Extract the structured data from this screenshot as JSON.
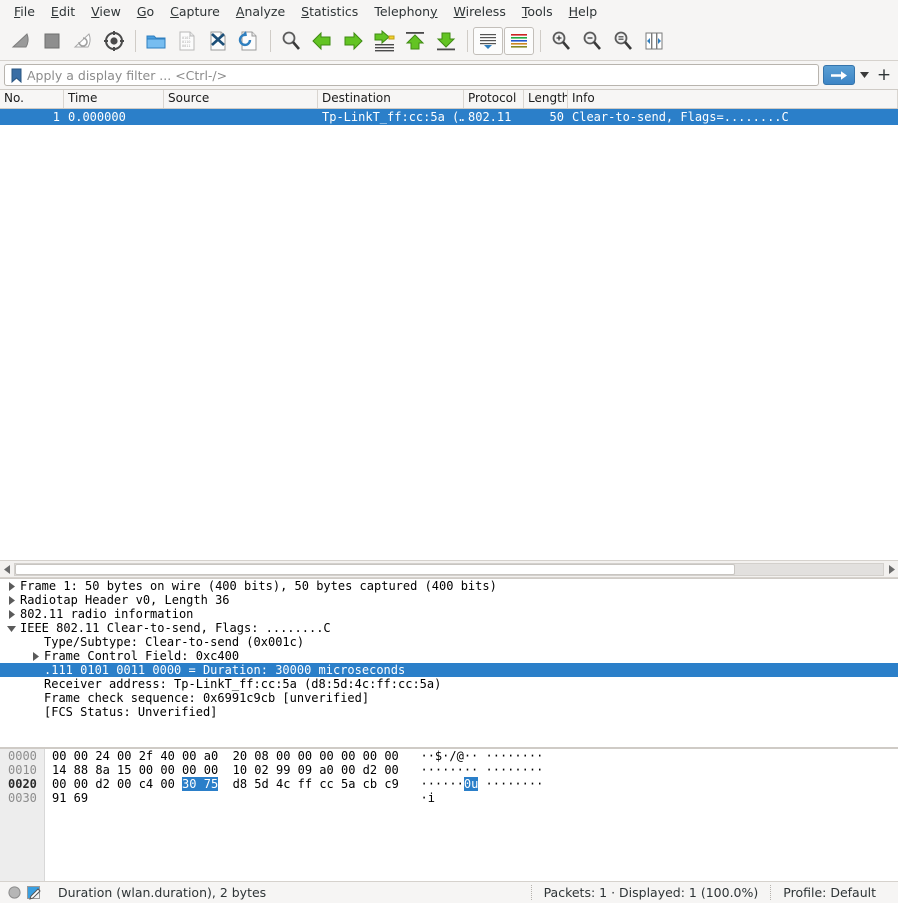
{
  "menu": {
    "items": [
      {
        "label": "File",
        "mnemonic": "F"
      },
      {
        "label": "Edit",
        "mnemonic": "E"
      },
      {
        "label": "View",
        "mnemonic": "V"
      },
      {
        "label": "Go",
        "mnemonic": "G"
      },
      {
        "label": "Capture",
        "mnemonic": "C"
      },
      {
        "label": "Analyze",
        "mnemonic": "A"
      },
      {
        "label": "Statistics",
        "mnemonic": "S"
      },
      {
        "label": "Telephony",
        "mnemonic": "T"
      },
      {
        "label": "Wireless",
        "mnemonic": "W"
      },
      {
        "label": "Tools",
        "mnemonic": "T"
      },
      {
        "label": "Help",
        "mnemonic": "H"
      }
    ]
  },
  "toolbar": {
    "buttons": [
      {
        "name": "start-capture-icon",
        "title": "Start capturing packets"
      },
      {
        "name": "stop-capture-icon",
        "title": "Stop capturing packets"
      },
      {
        "name": "restart-capture-icon",
        "title": "Restart current capture"
      },
      {
        "name": "capture-options-icon",
        "title": "Capture options"
      },
      {
        "name": "open-file-icon",
        "title": "Open a capture file"
      },
      {
        "name": "save-file-icon",
        "title": "Save this capture file"
      },
      {
        "name": "close-file-icon",
        "title": "Close this capture file"
      },
      {
        "name": "reload-file-icon",
        "title": "Reload this file"
      },
      {
        "name": "find-packet-icon",
        "title": "Find a packet"
      },
      {
        "name": "go-back-icon",
        "title": "Go back in packet history"
      },
      {
        "name": "go-forward-icon",
        "title": "Go forward in packet history"
      },
      {
        "name": "go-to-packet-icon",
        "title": "Go to the packet with number"
      },
      {
        "name": "go-to-first-icon",
        "title": "Go to the first packet"
      },
      {
        "name": "go-to-last-icon",
        "title": "Go to the last packet"
      },
      {
        "name": "auto-scroll-icon",
        "title": "Auto scroll in live capture"
      },
      {
        "name": "colorize-icon",
        "title": "Colorize packet list"
      },
      {
        "name": "zoom-in-icon",
        "title": "Zoom in"
      },
      {
        "name": "zoom-out-icon",
        "title": "Zoom out"
      },
      {
        "name": "zoom-reset-icon",
        "title": "Reset zoom level"
      },
      {
        "name": "resize-columns-icon",
        "title": "Resize columns"
      }
    ]
  },
  "filter": {
    "placeholder": "Apply a display filter ... <Ctrl-/>",
    "value": "",
    "apply_label": "",
    "plus_label": "+"
  },
  "packet_list": {
    "columns": [
      {
        "key": "no",
        "label": "No."
      },
      {
        "key": "time",
        "label": "Time"
      },
      {
        "key": "source",
        "label": "Source"
      },
      {
        "key": "destination",
        "label": "Destination"
      },
      {
        "key": "protocol",
        "label": "Protocol"
      },
      {
        "key": "length",
        "label": "Length"
      },
      {
        "key": "info",
        "label": "Info"
      }
    ],
    "rows": [
      {
        "no": "1",
        "time": "0.000000",
        "source": "",
        "destination": "Tp-LinkT_ff:cc:5a (…",
        "protocol": "802.11",
        "length": "50",
        "info": "Clear-to-send, Flags=........C",
        "selected": true
      }
    ]
  },
  "detail_tree": [
    {
      "label": "Frame 1: 50 bytes on wire (400 bits), 50 bytes captured (400 bits)",
      "indent": 0,
      "arrow": "collapsed",
      "selected": false
    },
    {
      "label": "Radiotap Header v0, Length 36",
      "indent": 0,
      "arrow": "collapsed",
      "selected": false
    },
    {
      "label": "802.11 radio information",
      "indent": 0,
      "arrow": "collapsed",
      "selected": false
    },
    {
      "label": "IEEE 802.11 Clear-to-send, Flags: ........C",
      "indent": 0,
      "arrow": "expanded",
      "selected": false
    },
    {
      "label": "Type/Subtype: Clear-to-send (0x001c)",
      "indent": 1,
      "arrow": "none",
      "selected": false
    },
    {
      "label": "Frame Control Field: 0xc400",
      "indent": 1,
      "arrow": "collapsed",
      "selected": false
    },
    {
      "label": ".111 0101 0011 0000 = Duration: 30000 microseconds",
      "indent": 1,
      "arrow": "none",
      "selected": true
    },
    {
      "label": "Receiver address: Tp-LinkT_ff:cc:5a (d8:5d:4c:ff:cc:5a)",
      "indent": 1,
      "arrow": "none",
      "selected": false
    },
    {
      "label": "Frame check sequence: 0x6991c9cb [unverified]",
      "indent": 1,
      "arrow": "none",
      "selected": false
    },
    {
      "label": "[FCS Status: Unverified]",
      "indent": 1,
      "arrow": "none",
      "selected": false
    }
  ],
  "bytes_pane": {
    "rows": [
      {
        "offset": "0000",
        "offset_active": false,
        "hex_pre": "00 00 24 00 2f 40 00 a0  20 08 00 00 00 00 00 00",
        "hex_hl": "",
        "hex_post": "",
        "ascii_pre": "··$·/@·· ········",
        "ascii_hl": "",
        "ascii_post": ""
      },
      {
        "offset": "0010",
        "offset_active": false,
        "hex_pre": "14 88 8a 15 00 00 00 00  10 02 99 09 a0 00 d2 00",
        "hex_hl": "",
        "hex_post": "",
        "ascii_pre": "········ ········",
        "ascii_hl": "",
        "ascii_post": ""
      },
      {
        "offset": "0020",
        "offset_active": true,
        "hex_pre": "00 00 d2 00 c4 00 ",
        "hex_hl": "30 75",
        "hex_post": "  d8 5d 4c ff cc 5a cb c9",
        "ascii_pre": "······",
        "ascii_hl": "0u",
        "ascii_post": " ········"
      },
      {
        "offset": "0030",
        "offset_active": false,
        "hex_pre": "91 69",
        "hex_hl": "",
        "hex_post": "",
        "ascii_pre": "·i",
        "ascii_hl": "",
        "ascii_post": ""
      }
    ]
  },
  "status_bar": {
    "field_info": "Duration (wlan.duration), 2 bytes",
    "packets": "Packets: 1 · Displayed: 1 (100.0%)",
    "profile": "Profile: Default"
  },
  "colors": {
    "selection_blue": "#2b7fc9",
    "chrome": "#f6f5f4",
    "accent_button": "#3d85c6"
  }
}
